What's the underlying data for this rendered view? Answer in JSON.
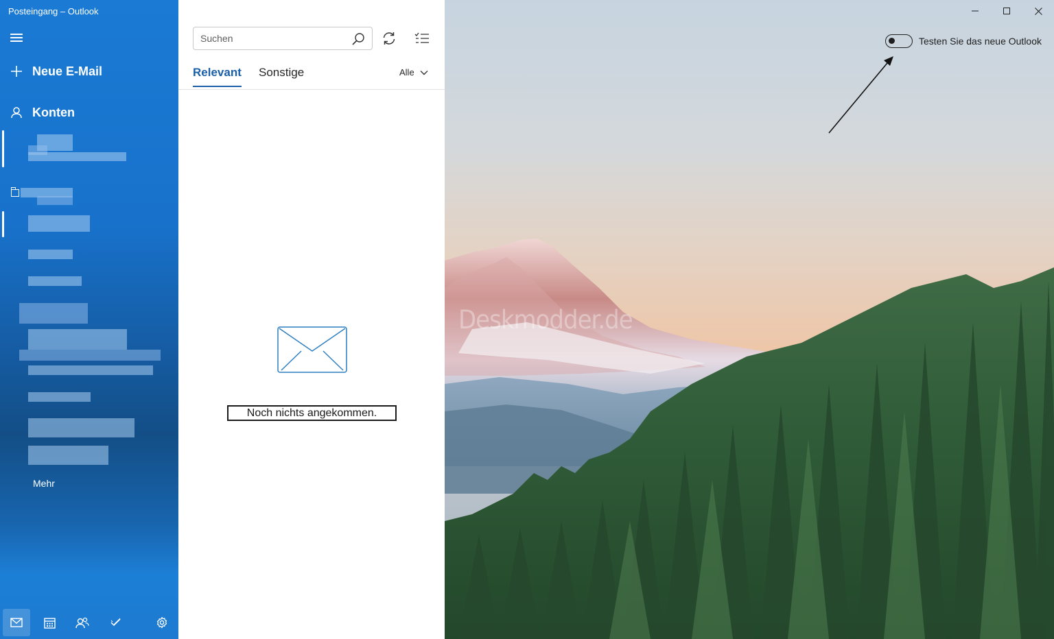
{
  "window": {
    "title": "Posteingang – Outlook"
  },
  "sidebar": {
    "menu_icon": "hamburger-menu-icon",
    "new_mail_label": "Neue E-Mail",
    "accounts_label": "Konten",
    "more_label": "Mehr",
    "bottom_nav": [
      {
        "name": "mail-icon",
        "active": true
      },
      {
        "name": "calendar-icon",
        "active": false
      },
      {
        "name": "people-icon",
        "active": false
      },
      {
        "name": "todo-icon",
        "active": false
      },
      {
        "name": "settings-icon",
        "active": false
      }
    ]
  },
  "message_list": {
    "search": {
      "placeholder": "Suchen"
    },
    "tabs": [
      {
        "label": "Relevant",
        "active": true
      },
      {
        "label": "Sonstige",
        "active": false
      }
    ],
    "filter_label": "Alle",
    "empty_text": "Noch nichts angekommen."
  },
  "reading_pane": {
    "toggle": {
      "label": "Testen Sie das neue Outlook",
      "state": "off"
    },
    "watermark": "Deskmodder.de"
  },
  "colors": {
    "sidebar_accent": "#1a7ad4",
    "tab_active": "#1a5fa8",
    "envelope": "#2d7fc1"
  }
}
